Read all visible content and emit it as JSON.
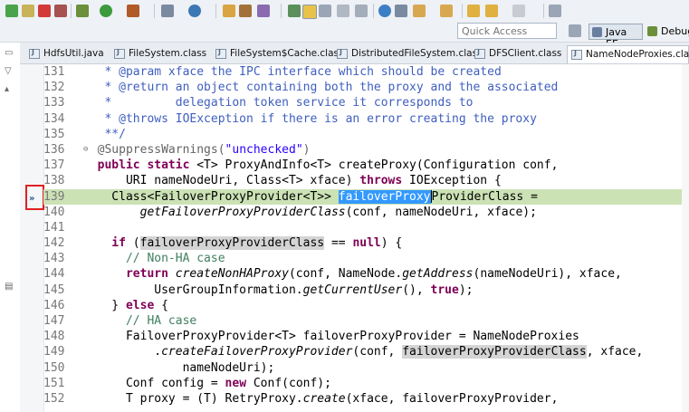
{
  "quick_access": {
    "placeholder": "Quick Access"
  },
  "perspectives": [
    {
      "label": "Java EE",
      "active": true
    },
    {
      "label": "Debug",
      "active": false
    }
  ],
  "tabs": [
    {
      "label": "HdfsUtil.java"
    },
    {
      "label": "FileSystem.class"
    },
    {
      "label": "FileSystem$Cache.class"
    },
    {
      "label": "DistributedFileSystem.class"
    },
    {
      "label": "DFSClient.class"
    },
    {
      "label": "NameNodeProxies.class"
    }
  ],
  "active_tab": "NameNodeProxies.class",
  "editor": {
    "lines": [
      {
        "num": "131",
        "code": [
          [
            "doc",
            "   * @param xface the IPC interface which should be created"
          ]
        ]
      },
      {
        "num": "132",
        "code": [
          [
            "doc",
            "   * @return an object containing both the proxy and the associated"
          ]
        ]
      },
      {
        "num": "133",
        "code": [
          [
            "doc",
            "   *         delegation token service it corresponds to"
          ]
        ]
      },
      {
        "num": "134",
        "code": [
          [
            "doc",
            "   * @throws IOException if there is an error creating the proxy"
          ]
        ]
      },
      {
        "num": "135",
        "code": [
          [
            "doc",
            "   **/"
          ]
        ]
      },
      {
        "num": "136",
        "fold": "⊖",
        "code": [
          [
            "ann",
            "  @SuppressWarnings("
          ],
          [
            "str",
            "\"unchecked\""
          ],
          [
            "ann",
            ")"
          ]
        ]
      },
      {
        "num": "137",
        "code": [
          [
            "kw",
            "  public static "
          ],
          [
            "",
            "<T> ProxyAndInfo<T> createProxy(Configuration conf,"
          ]
        ]
      },
      {
        "num": "138",
        "code": [
          [
            "",
            "      URI nameNodeUri, Class<T> xface) "
          ],
          [
            "kw",
            "throws"
          ],
          [
            "",
            " IOException {"
          ]
        ]
      },
      {
        "num": "139",
        "hl": true,
        "code": [
          [
            "",
            "    Class<FailoverProxyProvider<T>> "
          ],
          [
            "sel",
            "failoverProxy"
          ],
          [
            "caret",
            ""
          ],
          [
            "",
            "ProviderClass ="
          ]
        ]
      },
      {
        "num": "140",
        "code": [
          [
            "",
            "        "
          ],
          [
            "it",
            "getFailoverProxyProviderClass"
          ],
          [
            "",
            "(conf, nameNodeUri, xface);"
          ]
        ]
      },
      {
        "num": "141",
        "code": [
          [
            "",
            ""
          ]
        ]
      },
      {
        "num": "142",
        "code": [
          [
            "kw",
            "    if"
          ],
          [
            "",
            " ("
          ],
          [
            "occ",
            "failoverProxyProviderClass"
          ],
          [
            "",
            " == "
          ],
          [
            "kw",
            "null"
          ],
          [
            "",
            ") {"
          ]
        ]
      },
      {
        "num": "143",
        "code": [
          [
            "com",
            "      // Non-HA case"
          ]
        ]
      },
      {
        "num": "144",
        "code": [
          [
            "kw",
            "      return "
          ],
          [
            "it",
            "createNonHAProxy"
          ],
          [
            "",
            "(conf, NameNode."
          ],
          [
            "it",
            "getAddress"
          ],
          [
            "",
            "(nameNodeUri), xface,"
          ]
        ]
      },
      {
        "num": "145",
        "code": [
          [
            "",
            "          UserGroupInformation."
          ],
          [
            "it",
            "getCurrentUser"
          ],
          [
            "",
            "(), "
          ],
          [
            "kw",
            "true"
          ],
          [
            "",
            ");"
          ]
        ]
      },
      {
        "num": "146",
        "code": [
          [
            "",
            "    } "
          ],
          [
            "kw",
            "else"
          ],
          [
            "",
            " {"
          ]
        ]
      },
      {
        "num": "147",
        "code": [
          [
            "com",
            "      // HA case"
          ]
        ]
      },
      {
        "num": "148",
        "code": [
          [
            "",
            "      FailoverProxyProvider<T> failoverProxyProvider = NameNodeProxies"
          ]
        ]
      },
      {
        "num": "149",
        "code": [
          [
            "",
            "          ."
          ],
          [
            "it",
            "createFailoverProxyProvider"
          ],
          [
            "",
            "(conf, "
          ],
          [
            "occ",
            "failoverProxyProviderClass"
          ],
          [
            "",
            ", xface,"
          ]
        ]
      },
      {
        "num": "150",
        "code": [
          [
            "",
            "              nameNodeUri);"
          ]
        ]
      },
      {
        "num": "151",
        "code": [
          [
            "",
            "      Conf config = "
          ],
          [
            "kw",
            "new"
          ],
          [
            "",
            " Conf(conf);"
          ]
        ]
      },
      {
        "num": "152",
        "code": [
          [
            "",
            "      T proxy = (T) RetryProxy."
          ],
          [
            "it",
            "create"
          ],
          [
            "",
            "(xface, failoverProxyProvider,"
          ]
        ]
      }
    ]
  },
  "colors": {
    "keyword": "#7f0055",
    "javadoc": "#3f5fbf",
    "comment": "#3f7f5f",
    "string": "#2a00ff",
    "line_highlight": "#cbe2b5",
    "selection": "#3399ff",
    "breakpoint_box": "#e02020"
  }
}
